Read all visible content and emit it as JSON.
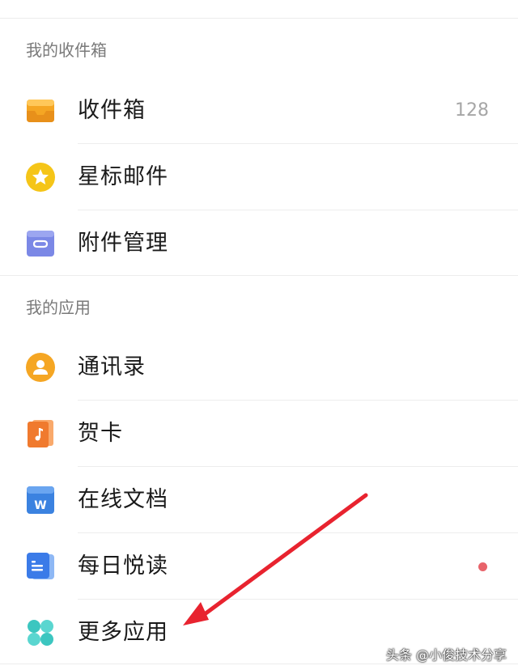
{
  "sections": {
    "mailbox_title": "我的收件箱",
    "apps_title": "我的应用"
  },
  "mailbox_items": [
    {
      "label": "收件箱",
      "count": "128",
      "icon": "inbox-tray-icon"
    },
    {
      "label": "星标邮件",
      "icon": "star-icon"
    },
    {
      "label": "附件管理",
      "icon": "attachment-icon"
    }
  ],
  "app_items": [
    {
      "label": "通讯录",
      "icon": "contacts-icon"
    },
    {
      "label": "贺卡",
      "icon": "greeting-card-icon"
    },
    {
      "label": "在线文档",
      "icon": "word-doc-icon"
    },
    {
      "label": "每日悦读",
      "icon": "reading-icon",
      "has_unread_dot": true
    },
    {
      "label": "更多应用",
      "icon": "more-apps-icon"
    }
  ],
  "colors": {
    "inbox": "#F5A623",
    "star": "#F5C518",
    "attachment": "#7B88E6",
    "contacts": "#F5A623",
    "card": "#F07A2E",
    "doc": "#3B82E0",
    "reading": "#3B7BE8",
    "more_apps": "#3CC6C0",
    "unread_dot": "#E8636A",
    "annotation_arrow": "#E8232F"
  },
  "watermark": "头条 @小俊技术分享"
}
